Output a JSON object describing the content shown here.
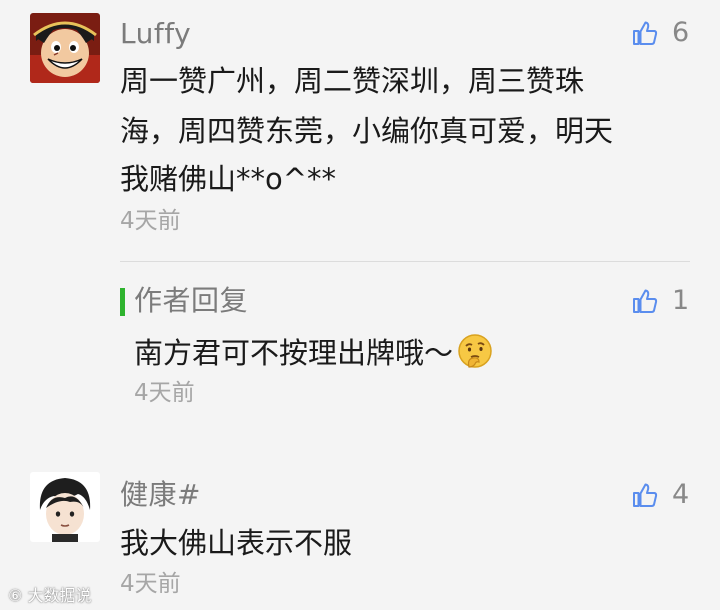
{
  "comments": [
    {
      "username": "Luffy",
      "lines": [
        "周一赞广州，周二赞深圳，周三赞珠",
        "海，周四赞东莞，小编你真可爱，明天",
        "我赌佛山**o^**"
      ],
      "time": "4天前",
      "likes": "6",
      "avatar_icon": "anime-pirate-avatar"
    },
    {
      "username": "健康#",
      "lines": [
        "我大佛山表示不服"
      ],
      "time": "4天前",
      "likes": "4",
      "avatar_icon": "cartoon-boy-avatar"
    }
  ],
  "author_reply": {
    "label": "作者回复",
    "text": "南方君可不按理出牌哦～",
    "emoji": "thinking-face-emoji",
    "time": "4天前",
    "likes": "1",
    "accent_color": "#2eb32e"
  },
  "watermark": "大数据说",
  "colors": {
    "background": "#f4f4f4",
    "name": "#7b7b7b",
    "text": "#1a1a1a",
    "time": "#a6a6a6",
    "thumb": "#5a8dee"
  }
}
